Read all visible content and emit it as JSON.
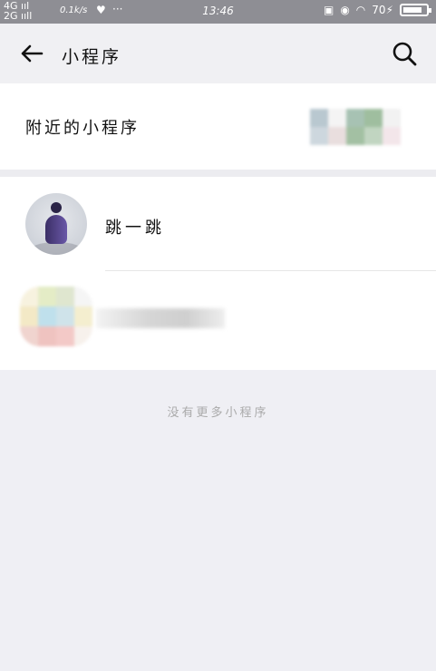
{
  "status_bar": {
    "signal_top": "4G",
    "signal_bottom": "2G",
    "net_speed": "0.1k/s",
    "heart": "♥",
    "dots": "···",
    "time": "13:46",
    "battery_percent": "70"
  },
  "header": {
    "title": "小程序",
    "back_icon": "back-arrow-icon",
    "search_icon": "search-icon"
  },
  "nearby": {
    "label": "附近的小程序"
  },
  "list": {
    "items": [
      {
        "label": "跳一跳"
      },
      {
        "label": ""
      }
    ]
  },
  "footer": {
    "text": "没有更多小程序"
  }
}
